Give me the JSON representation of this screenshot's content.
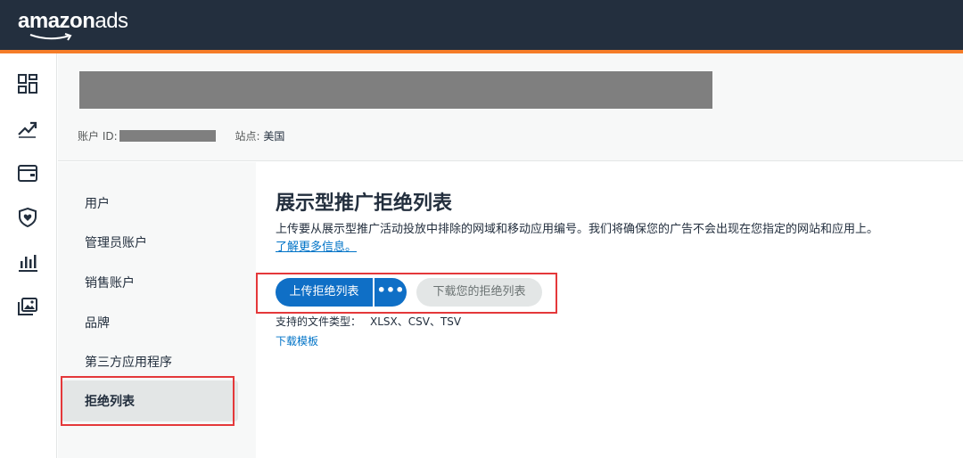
{
  "brand": {
    "logo_bold": "amazon",
    "logo_light": "ads",
    "colors": {
      "topbar": "#232f3e",
      "accent": "#f57c28",
      "primary": "#0f6fc6",
      "link": "#0073c7",
      "highlight": "#e4383a"
    }
  },
  "rail": {
    "icons": [
      "dashboard-icon",
      "trend-up-icon",
      "wallet-icon",
      "shield-heart-icon",
      "bar-chart-icon",
      "media-gallery-icon"
    ]
  },
  "account": {
    "id_label": "账户 ID:",
    "marketplace_label": "站点:",
    "marketplace_value": "美国"
  },
  "subnav": {
    "items": [
      {
        "label": "用户"
      },
      {
        "label": "管理员账户"
      },
      {
        "label": "销售账户"
      },
      {
        "label": "品牌"
      },
      {
        "label": "第三方应用程序"
      },
      {
        "label": "拒绝列表"
      }
    ],
    "active": "拒绝列表"
  },
  "main": {
    "title": "展示型推广拒绝列表",
    "description": "上传要从展示型推广活动投放中排除的网域和移动应用编号。我们将确保您的广告不会出现在您指定的网站和应用上。",
    "learn_more": "了解更多信息。",
    "upload_button": "上传拒绝列表",
    "more_button": "•••",
    "download_list_button": "下载您的拒绝列表",
    "file_types_label": "支持的文件类型：",
    "file_types_value": "XLSX、CSV、TSV",
    "download_template": "下载模板"
  }
}
